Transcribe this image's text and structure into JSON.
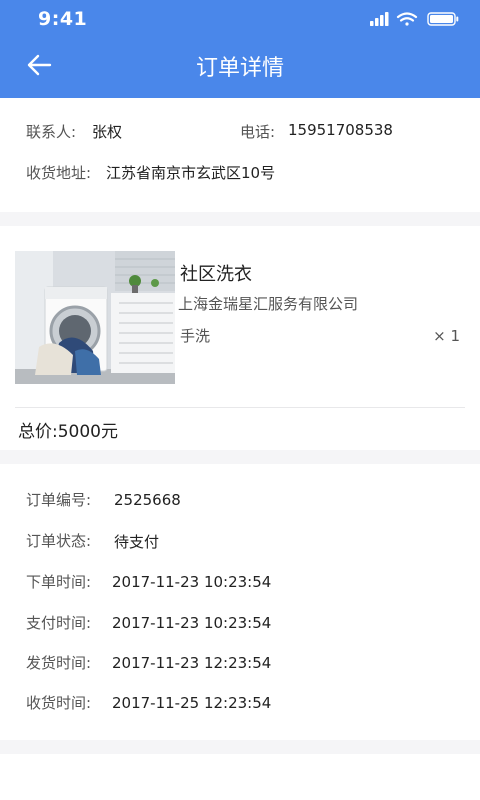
{
  "status_bar": {
    "time": "9:41"
  },
  "nav": {
    "title": "订单详情"
  },
  "contact": {
    "name_label": "联系人:",
    "name": "张权",
    "phone_label": "电话:",
    "phone": "15951708538",
    "address_label": "收货地址:",
    "address": "江苏省南京市玄武区10号"
  },
  "product": {
    "name": "社区洗衣",
    "shop": "上海金瑞星汇服务有限公司",
    "spec": "手洗",
    "qty": "× 1"
  },
  "total": {
    "label": "总价:",
    "value": "5000元"
  },
  "order_info": {
    "items": [
      {
        "label": "订单编号:",
        "value": "2525668"
      },
      {
        "label": "订单状态:",
        "value": "待支付"
      },
      {
        "label": "下单时间:",
        "value": "2017-11-23 10:23:54"
      },
      {
        "label": "支付时间:",
        "value": "2017-11-23 10:23:54"
      },
      {
        "label": "发货时间:",
        "value": "2017-11-23 12:23:54"
      },
      {
        "label": "收货时间:",
        "value": "2017-11-25 12:23:54"
      }
    ]
  },
  "colors": {
    "header": "#4a87ea",
    "background": "#f5f5f7"
  },
  "icons": {
    "back": "arrow-left-icon",
    "signal": "signal-icon",
    "wifi": "wifi-icon",
    "battery": "battery-icon"
  }
}
